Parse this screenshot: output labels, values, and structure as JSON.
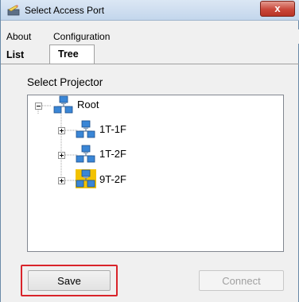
{
  "window": {
    "title": "Select Access Port",
    "close_glyph": "x"
  },
  "menu": {
    "items": [
      "About",
      "Configuration"
    ]
  },
  "tabs": [
    {
      "label": "List",
      "active": false
    },
    {
      "label": "Tree",
      "active": true
    }
  ],
  "section_label": "Select Projector",
  "tree": {
    "root": {
      "label": "Root",
      "expanded": true
    },
    "children": [
      {
        "label": "1T-1F",
        "expanded": false,
        "highlighted": false
      },
      {
        "label": "1T-2F",
        "expanded": false,
        "highlighted": false
      },
      {
        "label": "9T-2F",
        "expanded": false,
        "highlighted": true
      }
    ]
  },
  "buttons": {
    "save_label": "Save",
    "connect_label": "Connect",
    "connect_enabled": false
  },
  "colors": {
    "highlight_border": "#d9242a",
    "node_highlight": "#f2c200",
    "close_button": "#c9473a"
  },
  "icons": {
    "app": "pencil-window-icon",
    "node": "network-computers-icon",
    "expand": "plus-box-icon",
    "collapse": "minus-box-icon"
  }
}
